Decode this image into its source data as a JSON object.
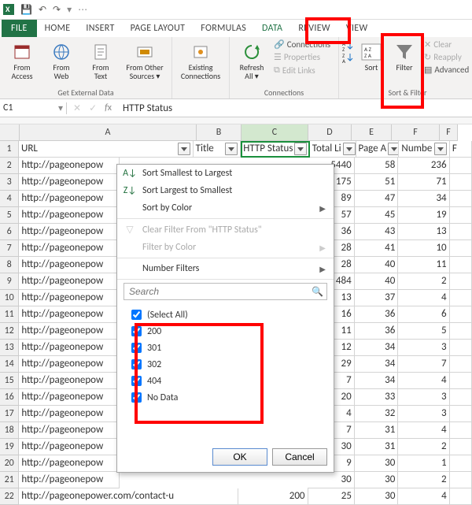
{
  "qat": {
    "save": "💾",
    "undo": "↶",
    "redo": "↷"
  },
  "tabs": {
    "file": "FILE",
    "home": "HOME",
    "insert": "INSERT",
    "page_layout": "PAGE LAYOUT",
    "formulas": "FORMULAS",
    "data": "DATA",
    "review": "REVIEW",
    "view": "VIEW"
  },
  "ribbon": {
    "get_external": {
      "from_access": "From\nAccess",
      "from_web": "From\nWeb",
      "from_text": "From\nText",
      "from_other": "From Other\nSources ▾",
      "group": "Get External Data"
    },
    "existing": "Existing\nConnections",
    "refresh": "Refresh\nAll ▾",
    "connections": {
      "connections": "Connections",
      "properties": "Properties",
      "edit_links": "Edit Links",
      "group": "Connections"
    },
    "sort": {
      "sort": "Sort",
      "filter": "Filter",
      "clear": "Clear",
      "reapply": "Reapply",
      "advanced": "Advanced",
      "group": "Sort & Filter"
    }
  },
  "namebox": "C1",
  "formula": "HTTP Status",
  "columns": {
    "A": "A",
    "B": "B",
    "C": "C",
    "D": "D",
    "E": "E",
    "F": "F",
    "G": "F"
  },
  "headers": {
    "url": "URL",
    "title": "Title",
    "http": "HTTP Status",
    "total": "Total Li",
    "page": "Page A",
    "num": "Numbe",
    "last": "F"
  },
  "rows": [
    {
      "n": 2,
      "url": "http://pageonepow",
      "d": 5440,
      "e": 58,
      "f": 236
    },
    {
      "n": 3,
      "url": "http://pageonepow",
      "d": 175,
      "e": 51,
      "f": 71
    },
    {
      "n": 4,
      "url": "http://pageonepow",
      "d": 89,
      "e": 47,
      "f": 34
    },
    {
      "n": 5,
      "url": "http://pageonepow",
      "d": 57,
      "e": 45,
      "f": 19
    },
    {
      "n": 6,
      "url": "http://pageonepow",
      "d": 36,
      "e": 43,
      "f": 13
    },
    {
      "n": 7,
      "url": "http://pageonepow",
      "d": 28,
      "e": 41,
      "f": 10
    },
    {
      "n": 8,
      "url": "http://pageonepow",
      "d": 28,
      "e": 40,
      "f": 11
    },
    {
      "n": 9,
      "url": "http://pageonepow",
      "d": 484,
      "e": 40,
      "f": 2
    },
    {
      "n": 10,
      "url": "http://pageonepow",
      "d": 13,
      "e": 37,
      "f": 4
    },
    {
      "n": 11,
      "url": "http://pageonepow",
      "d": 16,
      "e": 36,
      "f": 6
    },
    {
      "n": 12,
      "url": "http://pageonepow",
      "d": 11,
      "e": 36,
      "f": 5
    },
    {
      "n": 13,
      "url": "http://pageonepow",
      "d": 12,
      "e": 34,
      "f": 3
    },
    {
      "n": 14,
      "url": "http://pageonepow",
      "d": 29,
      "e": 34,
      "f": 7
    },
    {
      "n": 15,
      "url": "http://pageonepow",
      "d": 7,
      "e": 34,
      "f": 4
    },
    {
      "n": 16,
      "url": "http://pageonepow",
      "d": 20,
      "e": 33,
      "f": 3
    },
    {
      "n": 17,
      "url": "http://pageonepow",
      "d": 4,
      "e": 32,
      "f": 3
    },
    {
      "n": 18,
      "url": "http://pageonepow",
      "d": 7,
      "e": 31,
      "f": 4
    },
    {
      "n": 19,
      "url": "http://pageonepow",
      "d": 30,
      "e": 31,
      "f": 2
    },
    {
      "n": 20,
      "url": "http://pageonepow",
      "d": 9,
      "e": 30,
      "f": 1
    },
    {
      "n": 21,
      "url": "http://pageonepow",
      "d": 30,
      "e": 30,
      "f": 2
    }
  ],
  "row22": {
    "n": 22,
    "url": "http://pageonepower.com/contact-u",
    "c": 200,
    "d": 25,
    "e": 30,
    "f": 4
  },
  "menu": {
    "sort_asc": "Sort Smallest to Largest",
    "sort_desc": "Sort Largest to Smallest",
    "sort_color": "Sort by Color",
    "clear_filter": "Clear Filter From \"HTTP Status\"",
    "filter_color": "Filter by Color",
    "num_filters": "Number Filters",
    "search_placeholder": "Search",
    "opts": [
      "(Select All)",
      "200",
      "301",
      "302",
      "404",
      "No Data"
    ],
    "ok": "OK",
    "cancel": "Cancel"
  }
}
